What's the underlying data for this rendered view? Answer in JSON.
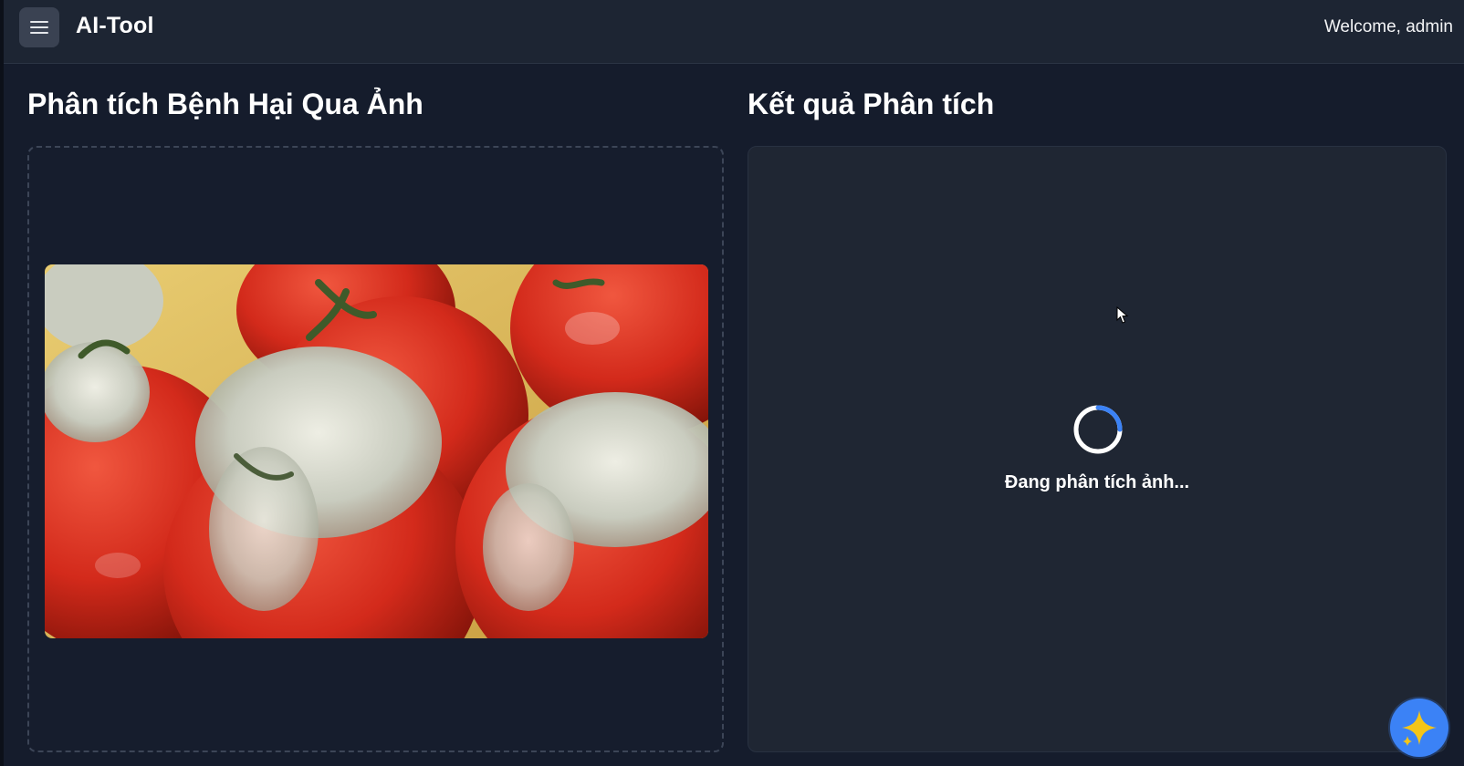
{
  "header": {
    "menu_icon": "hamburger-menu-icon",
    "app_title": "AI-Tool",
    "welcome_text": "Welcome, admin"
  },
  "upload": {
    "title": "Phân tích Bệnh Hại Qua Ảnh"
  },
  "result": {
    "title": "Kết quả Phân tích",
    "loading_text": "Đang phân tích ảnh...",
    "spinner_icon": "loading-spinner-icon"
  },
  "fab": {
    "icon": "sparkle-icon"
  },
  "colors": {
    "accent": "#3b82f6",
    "background": "#151c2c",
    "panel": "#1f2633",
    "topbar": "#1d2533",
    "sparkle": "#f5c518"
  }
}
